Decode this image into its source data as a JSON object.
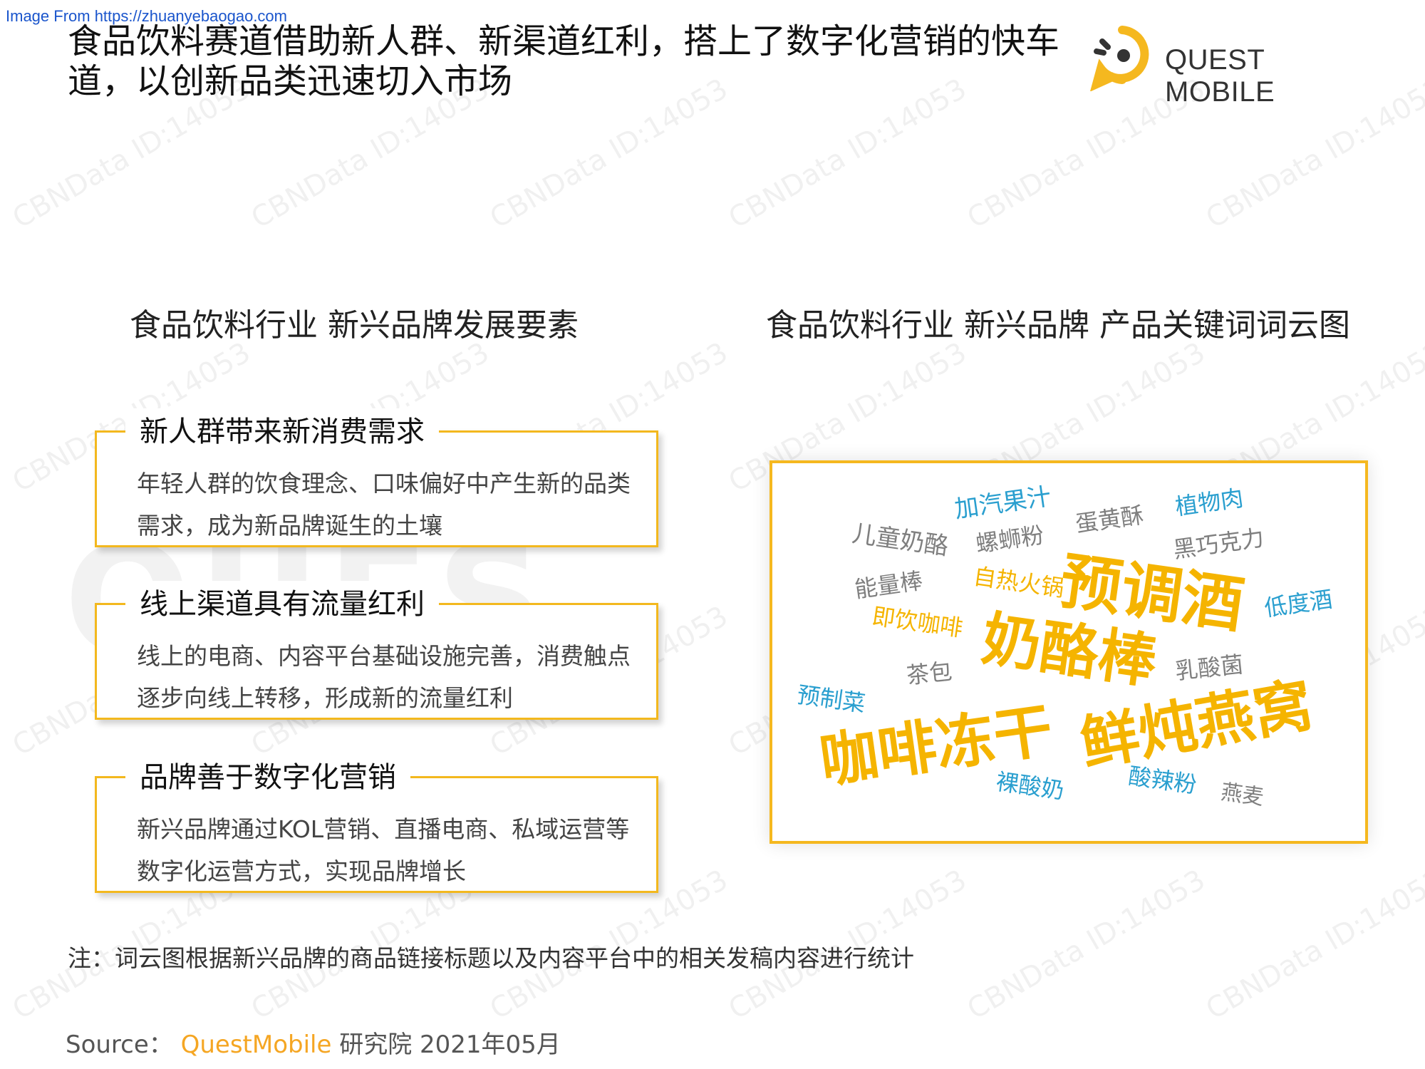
{
  "source_url": "Image From https://zhuanyebaogao.com",
  "title": "食品饮料赛道借助新人群、新渠道红利，搭上了数字化营销的快车道，以创新品类迅速切入市场",
  "logo": {
    "text": "QUEST MOBILE",
    "colors": {
      "ring": "#f5b81f",
      "dot": "#333333"
    }
  },
  "left_section": {
    "title": "食品饮料行业 新兴品牌发展要素",
    "cards": [
      {
        "head": "新人群带来新消费需求",
        "body": "年轻人群的饮食理念、口味偏好中产生新的品类需求，成为新品牌诞生的土壤"
      },
      {
        "head": "线上渠道具有流量红利",
        "body": "线上的电商、内容平台基础设施完善，消费触点逐步向线上转移，形成新的流量红利"
      },
      {
        "head": "品牌善于数字化营销",
        "body": "新兴品牌通过KOL营销、直播电商、私域运营等数字化运营方式，实现品牌增长"
      }
    ]
  },
  "right_section": {
    "title": "食品饮料行业 新兴品牌 产品关键词词云图",
    "words": [
      {
        "text": "加汽果汁",
        "color": "blue"
      },
      {
        "text": "蛋黄酥",
        "color": "gray"
      },
      {
        "text": "植物肉",
        "color": "blue"
      },
      {
        "text": "儿童奶酪",
        "color": "gray"
      },
      {
        "text": "螺蛳粉",
        "color": "gray"
      },
      {
        "text": "黑巧克力",
        "color": "gray"
      },
      {
        "text": "能量棒",
        "color": "gray"
      },
      {
        "text": "自热火锅",
        "color": "gold"
      },
      {
        "text": "预调酒",
        "color": "gold"
      },
      {
        "text": "低度酒",
        "color": "blue"
      },
      {
        "text": "即饮咖啡",
        "color": "gold"
      },
      {
        "text": "奶酪棒",
        "color": "gold"
      },
      {
        "text": "茶包",
        "color": "gray"
      },
      {
        "text": "乳酸菌",
        "color": "gray"
      },
      {
        "text": "预制菜",
        "color": "blue"
      },
      {
        "text": "咖啡冻干",
        "color": "gold"
      },
      {
        "text": "鲜炖燕窝",
        "color": "gold"
      },
      {
        "text": "裸酸奶",
        "color": "blue"
      },
      {
        "text": "酸辣粉",
        "color": "blue"
      },
      {
        "text": "燕麦",
        "color": "gray"
      }
    ]
  },
  "note": "注：词云图根据新兴品牌的商品链接标题以及内容平台中的相关发稿内容进行统计",
  "source": {
    "label": "Source：",
    "brand": "QuestMobile",
    "rest": "研究院 2021年05月"
  },
  "watermark": {
    "text": "CBNData ID:14053",
    "big_logo": "QUES"
  }
}
